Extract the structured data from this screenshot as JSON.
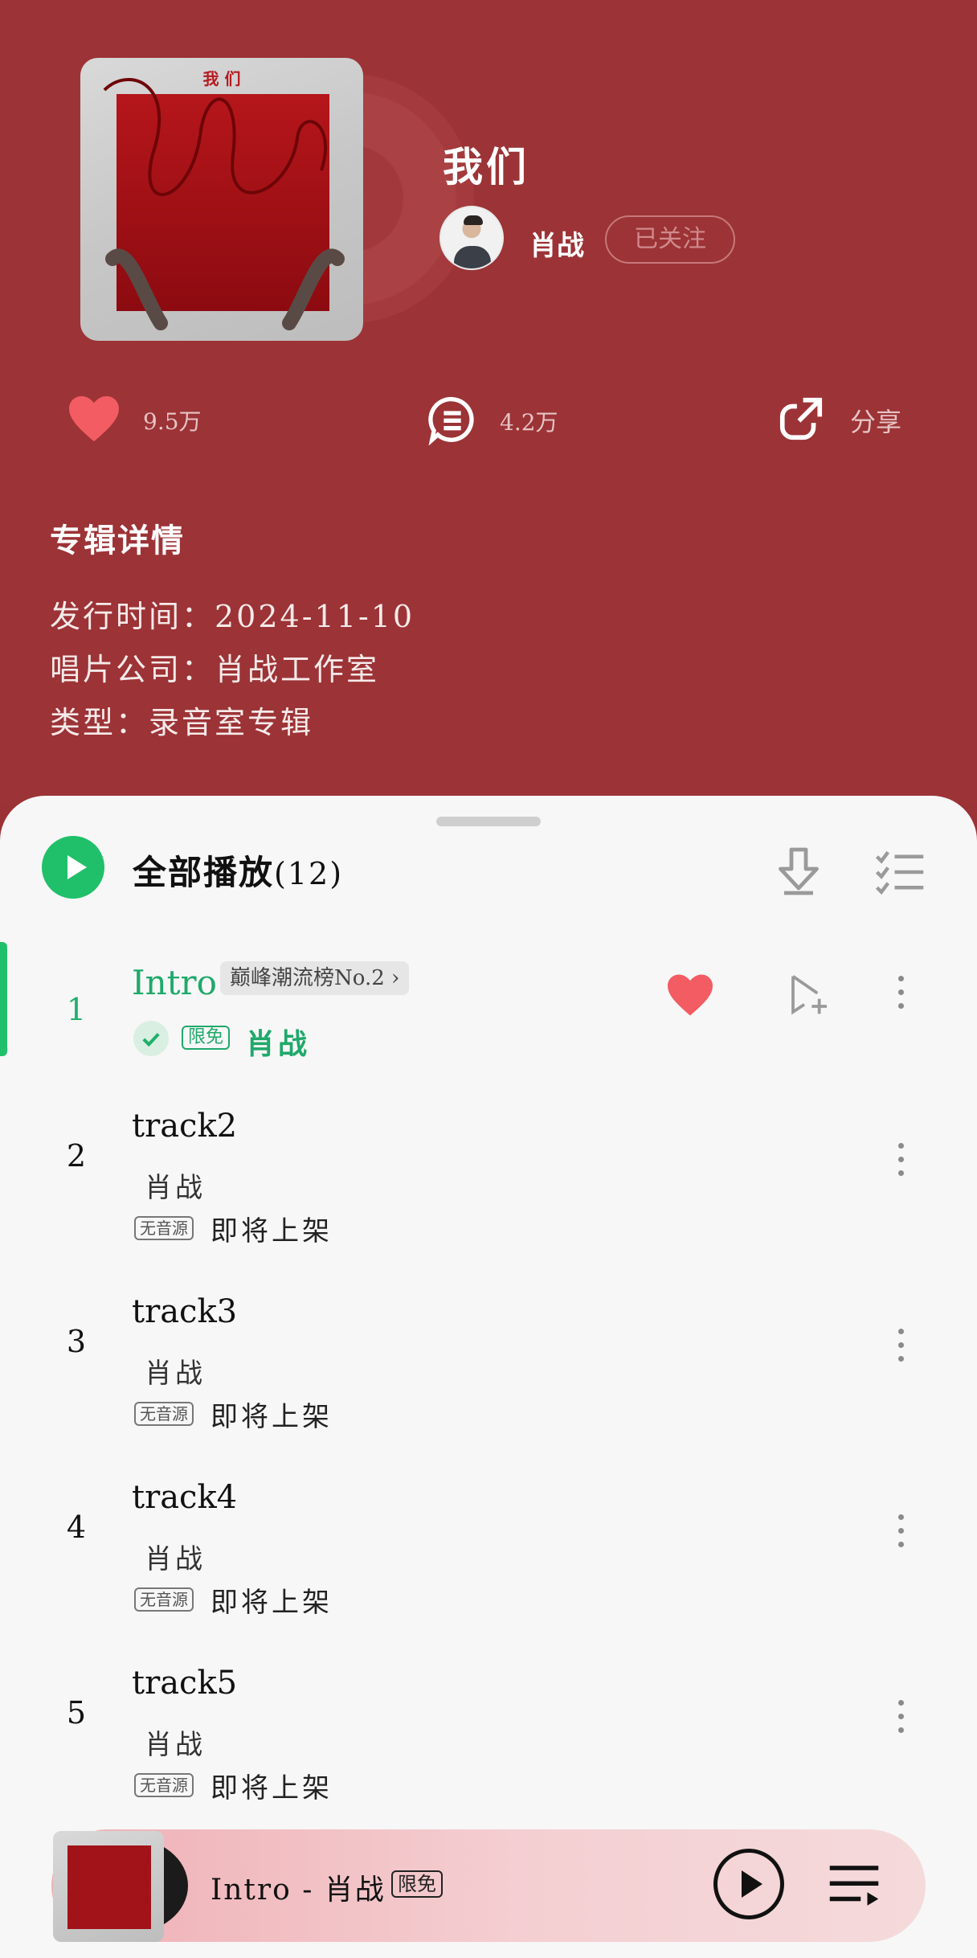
{
  "album": {
    "cover_text": "我 们",
    "title": "我们",
    "artist": "肖战",
    "follow_label": "已关注"
  },
  "stats": {
    "likes": "9.5万",
    "comments": "4.2万",
    "share_label": "分享"
  },
  "details": {
    "heading": "专辑详情",
    "release": "发行时间：2024-11-10",
    "label": "唱片公司：肖战工作室",
    "type": "类型：录音室专辑"
  },
  "play_all": {
    "label": "全部播放",
    "count": "(12)"
  },
  "tracks": [
    {
      "index": "1",
      "name": "Intro",
      "chart_tag": "巅峰潮流榜No.2 ›",
      "free_tag": "限免",
      "artist": "肖战",
      "liked": true
    },
    {
      "index": "2",
      "name": "track2",
      "artist": "肖战",
      "badge": "无音源",
      "status": "即将上架"
    },
    {
      "index": "3",
      "name": "track3",
      "artist": "肖战",
      "badge": "无音源",
      "status": "即将上架"
    },
    {
      "index": "4",
      "name": "track4",
      "artist": "肖战",
      "badge": "无音源",
      "status": "即将上架"
    },
    {
      "index": "5",
      "name": "track5",
      "artist": "肖战",
      "badge": "无音源",
      "status": "即将上架"
    }
  ],
  "mini_player": {
    "now_playing": "Intro - 肖战",
    "free_tag": "限免"
  },
  "colors": {
    "header_bg": "#9c3336",
    "accent_green": "#20c06a",
    "heart": "#f25c62"
  }
}
